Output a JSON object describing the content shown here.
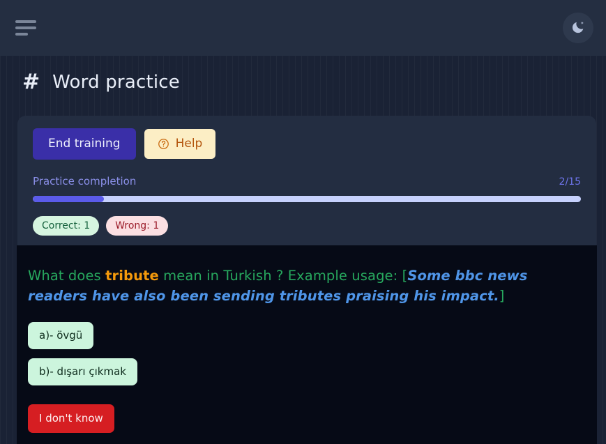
{
  "navbar": {
    "menu_icon": "hamburger-menu-icon",
    "theme_toggle_icon": "moon-icon"
  },
  "header": {
    "hash": "#",
    "title": "Word practice"
  },
  "toolbar": {
    "end_training_label": "End training",
    "help_label": "Help",
    "help_icon": "question-circle-icon"
  },
  "progress": {
    "label": "Practice completion",
    "count": "2/15",
    "percent": 13,
    "fill_color": "#5b5bea",
    "track_color": "#c6d1fd"
  },
  "scores": {
    "correct": "Correct: 1",
    "wrong": "Wrong: 1",
    "correct_color": "#14603c",
    "wrong_color": "#9b1c2a"
  },
  "question": {
    "prefix": "What does ",
    "word": "tribute",
    "middle": " mean in Turkish ? Example usage: [",
    "example": "Some bbc news readers have also been sending tributes praising his impact.",
    "suffix": "]",
    "text_color": "#27a85e",
    "word_color": "#f59a0b",
    "example_color": "#4f95e8"
  },
  "options": [
    {
      "label": "a)- övgü"
    },
    {
      "label": "b)- dışarı çıkmak"
    }
  ],
  "actions": {
    "dont_know_label": "I don't know",
    "dont_know_color": "#d61e22"
  }
}
